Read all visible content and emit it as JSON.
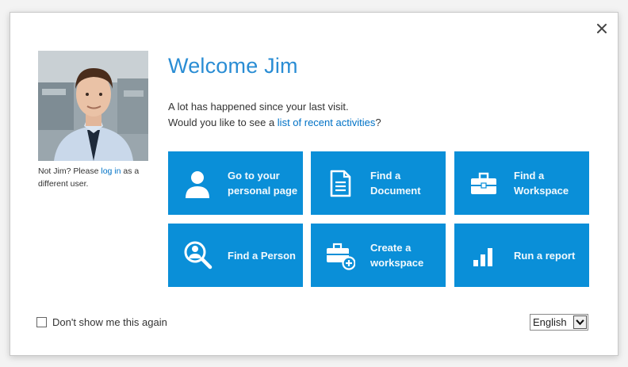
{
  "welcome": {
    "title": "Welcome Jim",
    "intro_line1": "A lot has happened since your last visit.",
    "intro_line2_prefix": "Would you like to see a ",
    "intro_link": "list of recent activities",
    "intro_line2_suffix": "?"
  },
  "user": {
    "not_user_prefix": "Not Jim? Please ",
    "log_in_link": "log in",
    "not_user_suffix": " as a different user."
  },
  "tiles": [
    {
      "label": "Go to your personal page",
      "icon": "person-icon"
    },
    {
      "label": "Find a Document",
      "icon": "document-icon"
    },
    {
      "label": "Find a Workspace",
      "icon": "briefcase-icon"
    },
    {
      "label": "Find a Person",
      "icon": "person-search-icon"
    },
    {
      "label": "Create a workspace",
      "icon": "briefcase-add-icon"
    },
    {
      "label": "Run a report",
      "icon": "bar-chart-icon"
    }
  ],
  "footer": {
    "dont_show_label": "Don't show me this again",
    "dont_show_checked": false,
    "language_selected": "English"
  },
  "colors": {
    "tile_background": "#0a8fd8",
    "title": "#2a8dd4",
    "link": "#0072c6"
  }
}
